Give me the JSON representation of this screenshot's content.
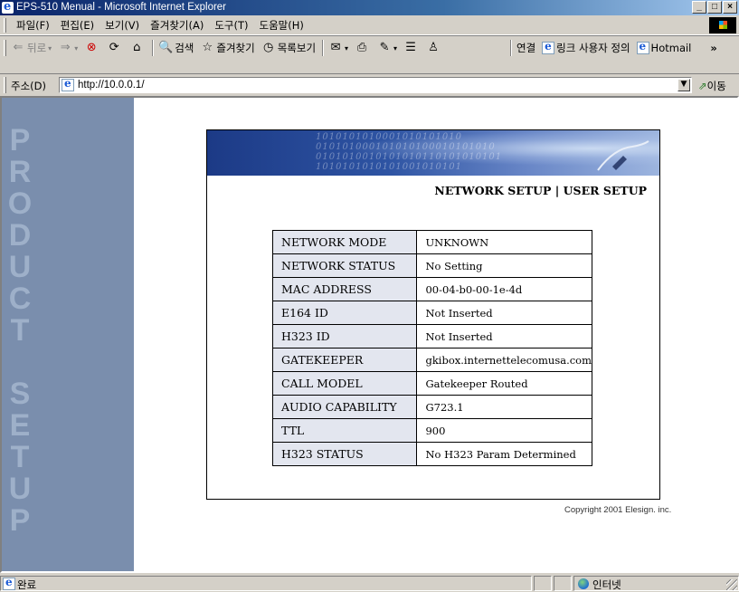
{
  "window": {
    "title": "EPS-510 Menual - Microsoft Internet Explorer",
    "controls": [
      "_",
      "□",
      "×"
    ]
  },
  "menu": {
    "items": [
      "파일(F)",
      "편집(E)",
      "보기(V)",
      "즐겨찾기(A)",
      "도구(T)",
      "도움말(H)"
    ]
  },
  "toolbar": {
    "back": "뒤로",
    "forward_icon": "forward-arrow-icon",
    "stop_icon": "stop-icon",
    "refresh_icon": "refresh-icon",
    "home_icon": "home-icon",
    "search": "검색",
    "favorites": "즐겨찾기",
    "history": "목록보기",
    "links_label": "연결",
    "link1": "링크 사용자 정의",
    "link2": "Hotmail",
    "more": "»"
  },
  "address": {
    "label": "주소(D)",
    "url": "http://10.0.0.1/",
    "go": "이동"
  },
  "side_panel": {
    "text": "PRODUCT SETUP",
    "color": "#7a8ead"
  },
  "page": {
    "nav_network": "NETWORK SETUP",
    "nav_sep": " | ",
    "nav_user": "USER SETUP",
    "copyright": "Copyright 2001 Elesign. inc.",
    "rows": [
      {
        "label": "NETWORK MODE",
        "value": "UNKNOWN"
      },
      {
        "label": "NETWORK STATUS",
        "value": "No Setting"
      },
      {
        "label": "MAC ADDRESS",
        "value": "00-04-b0-00-1e-4d"
      },
      {
        "label": "E164 ID",
        "value": "Not Inserted"
      },
      {
        "label": "H323 ID",
        "value": "Not Inserted"
      },
      {
        "label": "GATEKEEPER",
        "value": "gkibox.internettelecomusa.com"
      },
      {
        "label": "CALL MODEL",
        "value": "Gatekeeper Routed"
      },
      {
        "label": "AUDIO CAPABILITY",
        "value": "G723.1"
      },
      {
        "label": "TTL",
        "value": "900"
      },
      {
        "label": "H323 STATUS",
        "value": "No H323 Param Determined"
      }
    ]
  },
  "status": {
    "text": "완료",
    "zone": "인터넷"
  }
}
